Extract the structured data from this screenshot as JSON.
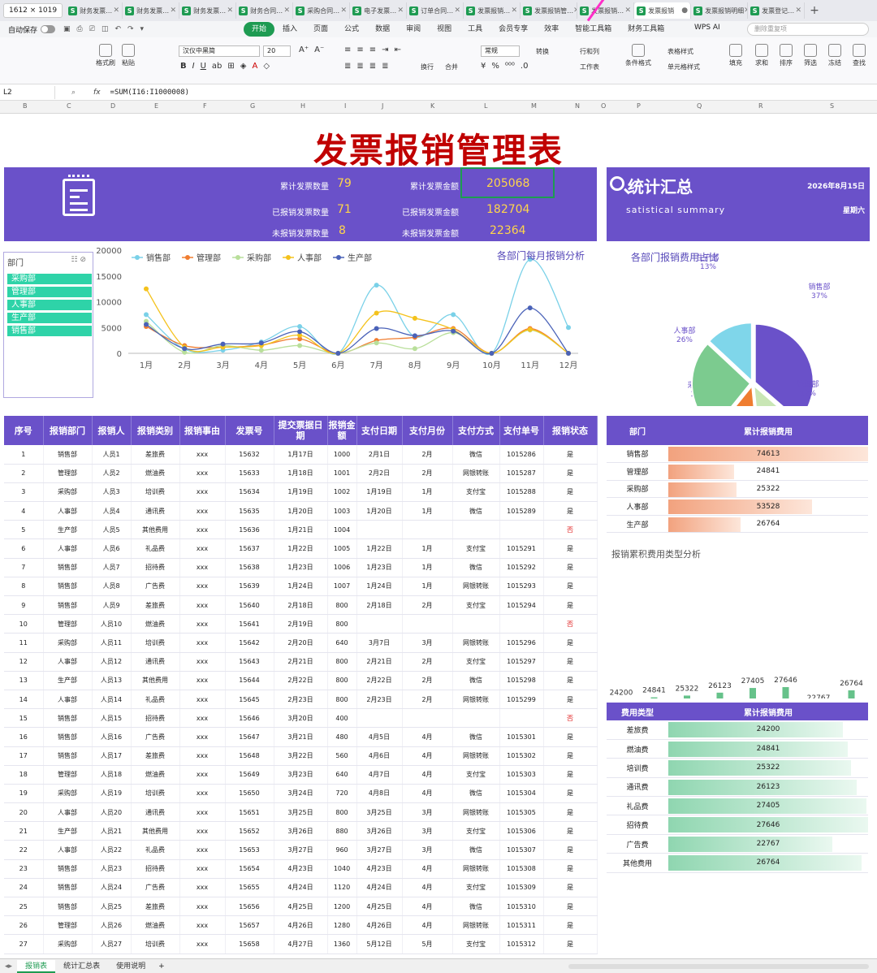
{
  "window": {
    "size_label": "1612 × 1019"
  },
  "tabs": [
    {
      "label": "财务发票…",
      "active": false
    },
    {
      "label": "财务发票…",
      "active": false
    },
    {
      "label": "财务发票…",
      "active": false
    },
    {
      "label": "财务合同…",
      "active": false
    },
    {
      "label": "采购合同…",
      "active": false
    },
    {
      "label": "电子发票…",
      "active": false
    },
    {
      "label": "订单合同…",
      "active": false
    },
    {
      "label": "发票报销…",
      "active": false
    },
    {
      "label": "发票报销管…",
      "active": false
    },
    {
      "label": "发票报销…",
      "active": false
    },
    {
      "label": "发票报销",
      "active": true
    },
    {
      "label": "发票报销明细",
      "active": false
    },
    {
      "label": "发票登记…",
      "active": false
    }
  ],
  "menubar": {
    "autosave": "自动保存",
    "menus": [
      "开始",
      "插入",
      "页面",
      "公式",
      "数据",
      "审阅",
      "视图",
      "工具",
      "会员专享",
      "效率",
      "智能工具箱",
      "财务工具箱"
    ],
    "active_menu": "开始",
    "wps_ai": "WPS AI",
    "search_placeholder": "删除重复项"
  },
  "ribbon": {
    "format_painter": "格式刷",
    "paste": "粘贴",
    "font": "汉仪中黑简",
    "font_size": "20",
    "wrap": "换行",
    "merge": "合并",
    "number_format": "常规",
    "convert": "转换",
    "row_col": "行和列",
    "worksheet": "工作表",
    "cond_format": "条件格式",
    "table_style": "表格样式",
    "cell_style": "单元格样式",
    "fill": "填充",
    "sum": "求和",
    "sort": "排序",
    "filter": "筛选",
    "freeze": "冻结",
    "find": "查找"
  },
  "formula": {
    "cell": "L2",
    "fx": "fx",
    "text": "=SUM(I16:I1000008)"
  },
  "columns": [
    "B",
    "C",
    "D",
    "E",
    "F",
    "G",
    "H",
    "I",
    "J",
    "K",
    "L",
    "M",
    "N",
    "O",
    "P",
    "Q",
    "R",
    "S"
  ],
  "title": "发票报销管理表",
  "kpi": [
    {
      "label": "累计发票数量",
      "value": "79"
    },
    {
      "label": "累计发票金额",
      "value": "205068"
    },
    {
      "label": "已报销发票数量",
      "value": "71"
    },
    {
      "label": "已报销发票金额",
      "value": "182704"
    },
    {
      "label": "未报销发票数量",
      "value": "8"
    },
    {
      "label": "未报销发票金额",
      "value": "22364"
    }
  ],
  "summary": {
    "title": "统计汇总",
    "subtitle": "satistical  summary",
    "date": "2026年8月15日",
    "weekday": "星期六"
  },
  "slicer": {
    "header": "部门",
    "items": [
      "采购部",
      "管理部",
      "人事部",
      "生产部",
      "销售部"
    ]
  },
  "chart_data": [
    {
      "type": "line",
      "title": "各部门每月报销分析",
      "categories": [
        "1月",
        "2月",
        "3月",
        "4月",
        "5月",
        "6月",
        "7月",
        "8月",
        "9月",
        "10月",
        "11月",
        "12月"
      ],
      "ylim": [
        0,
        20000
      ],
      "yticks": [
        0,
        5000,
        10000,
        15000,
        20000
      ],
      "legend_position": "top-left",
      "series": [
        {
          "name": "销售部",
          "color": "#7ad1e8",
          "values": [
            7500,
            800,
            600,
            2200,
            5200,
            0,
            13200,
            3200,
            7500,
            0,
            18200,
            5000
          ]
        },
        {
          "name": "管理部",
          "color": "#f07d30",
          "values": [
            5200,
            1500,
            1200,
            1600,
            2800,
            0,
            2500,
            3100,
            4800,
            0,
            4800,
            0
          ]
        },
        {
          "name": "采购部",
          "color": "#b9df9a",
          "values": [
            6200,
            200,
            1500,
            600,
            1500,
            0,
            2000,
            900,
            4000,
            0,
            4500,
            0
          ]
        },
        {
          "name": "人事部",
          "color": "#f4c21c",
          "values": [
            12500,
            1200,
            1200,
            1500,
            3500,
            0,
            7800,
            6800,
            4600,
            0,
            4600,
            0
          ]
        },
        {
          "name": "生产部",
          "color": "#4a62b8",
          "values": [
            5600,
            900,
            1800,
            2000,
            4200,
            0,
            4800,
            3400,
            4300,
            0,
            8800,
            0
          ]
        }
      ]
    },
    {
      "type": "pie",
      "title": "各部门报销费用占比",
      "slices": [
        {
          "label": "销售部",
          "percent": "37%",
          "value": 74613,
          "color": "#6a51c9"
        },
        {
          "label": "管理部",
          "percent": "12%",
          "value": 24841,
          "color": "#c9e6b5"
        },
        {
          "label": "采购部",
          "percent": "12%",
          "value": 25322,
          "color": "#ef7d30"
        },
        {
          "label": "人事部",
          "percent": "26%",
          "value": 53528,
          "color": "#7ccb8f"
        },
        {
          "label": "生产部",
          "percent": "13%",
          "value": 26764,
          "color": "#7fd6ea"
        }
      ]
    },
    {
      "type": "bar",
      "title": "报销累积费用类型分析",
      "categories": [
        "差旅费",
        "燃油费",
        "培训费",
        "通讯费",
        "礼品费",
        "招待费",
        "广告费",
        "其他费用"
      ],
      "values": [
        24200,
        24841,
        25322,
        26123,
        27405,
        27646,
        22767,
        26764
      ],
      "ylim": [
        0,
        30000
      ],
      "color": "#66c28a"
    }
  ],
  "main_table": {
    "headers": [
      "序号",
      "报销部门",
      "报销人",
      "报销类别",
      "报销事由",
      "发票号",
      "提交票据日期",
      "报销金额",
      "支付日期",
      "支付月份",
      "支付方式",
      "支付单号",
      "报销状态"
    ],
    "rows": [
      [
        "1",
        "销售部",
        "人员1",
        "差旅费",
        "xxx",
        "15632",
        "1月17日",
        "1000",
        "2月1日",
        "2月",
        "微信",
        "1015286",
        "是"
      ],
      [
        "2",
        "管理部",
        "人员2",
        "燃油费",
        "xxx",
        "15633",
        "1月18日",
        "1001",
        "2月2日",
        "2月",
        "网银转账",
        "1015287",
        "是"
      ],
      [
        "3",
        "采购部",
        "人员3",
        "培训费",
        "xxx",
        "15634",
        "1月19日",
        "1002",
        "1月19日",
        "1月",
        "支付宝",
        "1015288",
        "是"
      ],
      [
        "4",
        "人事部",
        "人员4",
        "通讯费",
        "xxx",
        "15635",
        "1月20日",
        "1003",
        "1月20日",
        "1月",
        "微信",
        "1015289",
        "是"
      ],
      [
        "5",
        "生产部",
        "人员5",
        "其他费用",
        "xxx",
        "15636",
        "1月21日",
        "1004",
        "",
        "",
        "",
        "",
        "否"
      ],
      [
        "6",
        "人事部",
        "人员6",
        "礼品费",
        "xxx",
        "15637",
        "1月22日",
        "1005",
        "1月22日",
        "1月",
        "支付宝",
        "1015291",
        "是"
      ],
      [
        "7",
        "销售部",
        "人员7",
        "招待费",
        "xxx",
        "15638",
        "1月23日",
        "1006",
        "1月23日",
        "1月",
        "微信",
        "1015292",
        "是"
      ],
      [
        "8",
        "销售部",
        "人员8",
        "广告费",
        "xxx",
        "15639",
        "1月24日",
        "1007",
        "1月24日",
        "1月",
        "网银转账",
        "1015293",
        "是"
      ],
      [
        "9",
        "销售部",
        "人员9",
        "差旅费",
        "xxx",
        "15640",
        "2月18日",
        "800",
        "2月18日",
        "2月",
        "支付宝",
        "1015294",
        "是"
      ],
      [
        "10",
        "管理部",
        "人员10",
        "燃油费",
        "xxx",
        "15641",
        "2月19日",
        "800",
        "",
        "",
        "",
        "",
        "否"
      ],
      [
        "11",
        "采购部",
        "人员11",
        "培训费",
        "xxx",
        "15642",
        "2月20日",
        "640",
        "3月7日",
        "3月",
        "网银转账",
        "1015296",
        "是"
      ],
      [
        "12",
        "人事部",
        "人员12",
        "通讯费",
        "xxx",
        "15643",
        "2月21日",
        "800",
        "2月21日",
        "2月",
        "支付宝",
        "1015297",
        "是"
      ],
      [
        "13",
        "生产部",
        "人员13",
        "其他费用",
        "xxx",
        "15644",
        "2月22日",
        "800",
        "2月22日",
        "2月",
        "微信",
        "1015298",
        "是"
      ],
      [
        "14",
        "人事部",
        "人员14",
        "礼品费",
        "xxx",
        "15645",
        "2月23日",
        "800",
        "2月23日",
        "2月",
        "网银转账",
        "1015299",
        "是"
      ],
      [
        "15",
        "销售部",
        "人员15",
        "招待费",
        "xxx",
        "15646",
        "3月20日",
        "400",
        "",
        "",
        "",
        "",
        "否"
      ],
      [
        "16",
        "销售部",
        "人员16",
        "广告费",
        "xxx",
        "15647",
        "3月21日",
        "480",
        "4月5日",
        "4月",
        "微信",
        "1015301",
        "是"
      ],
      [
        "17",
        "销售部",
        "人员17",
        "差旅费",
        "xxx",
        "15648",
        "3月22日",
        "560",
        "4月6日",
        "4月",
        "网银转账",
        "1015302",
        "是"
      ],
      [
        "18",
        "管理部",
        "人员18",
        "燃油费",
        "xxx",
        "15649",
        "3月23日",
        "640",
        "4月7日",
        "4月",
        "支付宝",
        "1015303",
        "是"
      ],
      [
        "19",
        "采购部",
        "人员19",
        "培训费",
        "xxx",
        "15650",
        "3月24日",
        "720",
        "4月8日",
        "4月",
        "微信",
        "1015304",
        "是"
      ],
      [
        "20",
        "人事部",
        "人员20",
        "通讯费",
        "xxx",
        "15651",
        "3月25日",
        "800",
        "3月25日",
        "3月",
        "网银转账",
        "1015305",
        "是"
      ],
      [
        "21",
        "生产部",
        "人员21",
        "其他费用",
        "xxx",
        "15652",
        "3月26日",
        "880",
        "3月26日",
        "3月",
        "支付宝",
        "1015306",
        "是"
      ],
      [
        "22",
        "人事部",
        "人员22",
        "礼品费",
        "xxx",
        "15653",
        "3月27日",
        "960",
        "3月27日",
        "3月",
        "微信",
        "1015307",
        "是"
      ],
      [
        "23",
        "销售部",
        "人员23",
        "招待费",
        "xxx",
        "15654",
        "4月23日",
        "1040",
        "4月23日",
        "4月",
        "网银转账",
        "1015308",
        "是"
      ],
      [
        "24",
        "销售部",
        "人员24",
        "广告费",
        "xxx",
        "15655",
        "4月24日",
        "1120",
        "4月24日",
        "4月",
        "支付宝",
        "1015309",
        "是"
      ],
      [
        "25",
        "销售部",
        "人员25",
        "差旅费",
        "xxx",
        "15656",
        "4月25日",
        "1200",
        "4月25日",
        "4月",
        "微信",
        "1015310",
        "是"
      ],
      [
        "26",
        "管理部",
        "人员26",
        "燃油费",
        "xxx",
        "15657",
        "4月26日",
        "1280",
        "4月26日",
        "4月",
        "网银转账",
        "1015311",
        "是"
      ],
      [
        "27",
        "采购部",
        "人员27",
        "培训费",
        "xxx",
        "15658",
        "4月27日",
        "1360",
        "5月12日",
        "5月",
        "支付宝",
        "1015312",
        "是"
      ]
    ]
  },
  "dept_table": {
    "headers": [
      "部门",
      "累计报销费用"
    ],
    "rows": [
      {
        "name": "销售部",
        "value": "74613",
        "ratio": 1.0
      },
      {
        "name": "管理部",
        "value": "24841",
        "ratio": 0.33
      },
      {
        "name": "采购部",
        "value": "25322",
        "ratio": 0.34
      },
      {
        "name": "人事部",
        "value": "53528",
        "ratio": 0.72
      },
      {
        "name": "生产部",
        "value": "26764",
        "ratio": 0.36
      }
    ]
  },
  "type_table": {
    "headers": [
      "费用类型",
      "累计报销费用"
    ],
    "rows": [
      {
        "name": "差旅费",
        "value": "24200",
        "ratio": 0.875
      },
      {
        "name": "燃油费",
        "value": "24841",
        "ratio": 0.898
      },
      {
        "name": "培训费",
        "value": "25322",
        "ratio": 0.916
      },
      {
        "name": "通讯费",
        "value": "26123",
        "ratio": 0.945
      },
      {
        "name": "礼品费",
        "value": "27405",
        "ratio": 0.991
      },
      {
        "name": "招待费",
        "value": "27646",
        "ratio": 1.0
      },
      {
        "name": "广告费",
        "value": "22767",
        "ratio": 0.823
      },
      {
        "name": "其他费用",
        "value": "26764",
        "ratio": 0.968
      }
    ]
  },
  "sheet_tabs": [
    {
      "label": "报销表",
      "active": true
    },
    {
      "label": "统计汇总表",
      "active": false
    },
    {
      "label": "使用说明",
      "active": false
    }
  ]
}
